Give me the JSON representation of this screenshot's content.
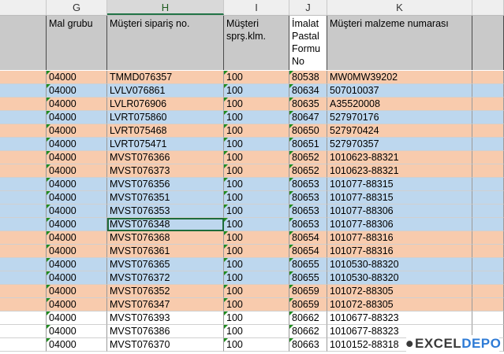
{
  "columns": [
    {
      "letter": "G",
      "header": "Mal grubu"
    },
    {
      "letter": "H",
      "header": "Müşteri sipariş no."
    },
    {
      "letter": "I",
      "header": "Müşteri\nsprş.klm."
    },
    {
      "letter": "J",
      "header": "İmalat\nPastal\nFormu\nNo"
    },
    {
      "letter": "K",
      "header": "Müşteri malzeme numarası"
    }
  ],
  "selected_column": "H",
  "selected_cell_value": "MVST076348",
  "rows": [
    {
      "color": "orange",
      "cells": [
        "04000",
        "TMMD076357",
        "100",
        "80538",
        "MW0MW39202"
      ]
    },
    {
      "color": "blue",
      "cells": [
        "04000",
        "LVLV076861",
        "100",
        "80634",
        "507010037"
      ]
    },
    {
      "color": "orange",
      "cells": [
        "04000",
        "LVLR076906",
        "100",
        "80635",
        "A35520008"
      ]
    },
    {
      "color": "blue",
      "cells": [
        "04000",
        "LVRT075860",
        "100",
        "80647",
        "527970176"
      ]
    },
    {
      "color": "orange",
      "cells": [
        "04000",
        "LVRT075468",
        "100",
        "80650",
        "527970424"
      ]
    },
    {
      "color": "blue",
      "cells": [
        "04000",
        "LVRT075471",
        "100",
        "80651",
        "527970357"
      ]
    },
    {
      "color": "orange",
      "cells": [
        "04000",
        "MVST076366",
        "100",
        "80652",
        "1010623-88321"
      ]
    },
    {
      "color": "orange",
      "cells": [
        "04000",
        "MVST076373",
        "100",
        "80652",
        "1010623-88321"
      ]
    },
    {
      "color": "blue",
      "cells": [
        "04000",
        "MVST076356",
        "100",
        "80653",
        "101077-88315"
      ]
    },
    {
      "color": "blue",
      "cells": [
        "04000",
        "MVST076351",
        "100",
        "80653",
        "101077-88315"
      ]
    },
    {
      "color": "blue",
      "cells": [
        "04000",
        "MVST076353",
        "100",
        "80653",
        "101077-88306"
      ]
    },
    {
      "color": "blue",
      "cells": [
        "04000",
        "MVST076348",
        "100",
        "80653",
        "101077-88306"
      ]
    },
    {
      "color": "orange",
      "cells": [
        "04000",
        "MVST076368",
        "100",
        "80654",
        "101077-88316"
      ]
    },
    {
      "color": "orange",
      "cells": [
        "04000",
        "MVST076361",
        "100",
        "80654",
        "101077-88316"
      ]
    },
    {
      "color": "blue",
      "cells": [
        "04000",
        "MVST076365",
        "100",
        "80655",
        "1010530-88320"
      ]
    },
    {
      "color": "blue",
      "cells": [
        "04000",
        "MVST076372",
        "100",
        "80655",
        "1010530-88320"
      ]
    },
    {
      "color": "orange",
      "cells": [
        "04000",
        "MVST076352",
        "100",
        "80659",
        "101072-88305"
      ]
    },
    {
      "color": "orange",
      "cells": [
        "04000",
        "MVST076347",
        "100",
        "80659",
        "101072-88305"
      ]
    },
    {
      "color": "white",
      "cells": [
        "04000",
        "MVST076393",
        "100",
        "80662",
        "1010677-88323"
      ]
    },
    {
      "color": "white",
      "cells": [
        "04000",
        "MVST076386",
        "100",
        "80662",
        "1010677-88323"
      ]
    },
    {
      "color": "white",
      "cells": [
        "04000",
        "MVST076370",
        "100",
        "80663",
        "1010152-88318"
      ]
    }
  ],
  "logo": {
    "prefix": "EXCEL",
    "accent": "DEPO"
  }
}
